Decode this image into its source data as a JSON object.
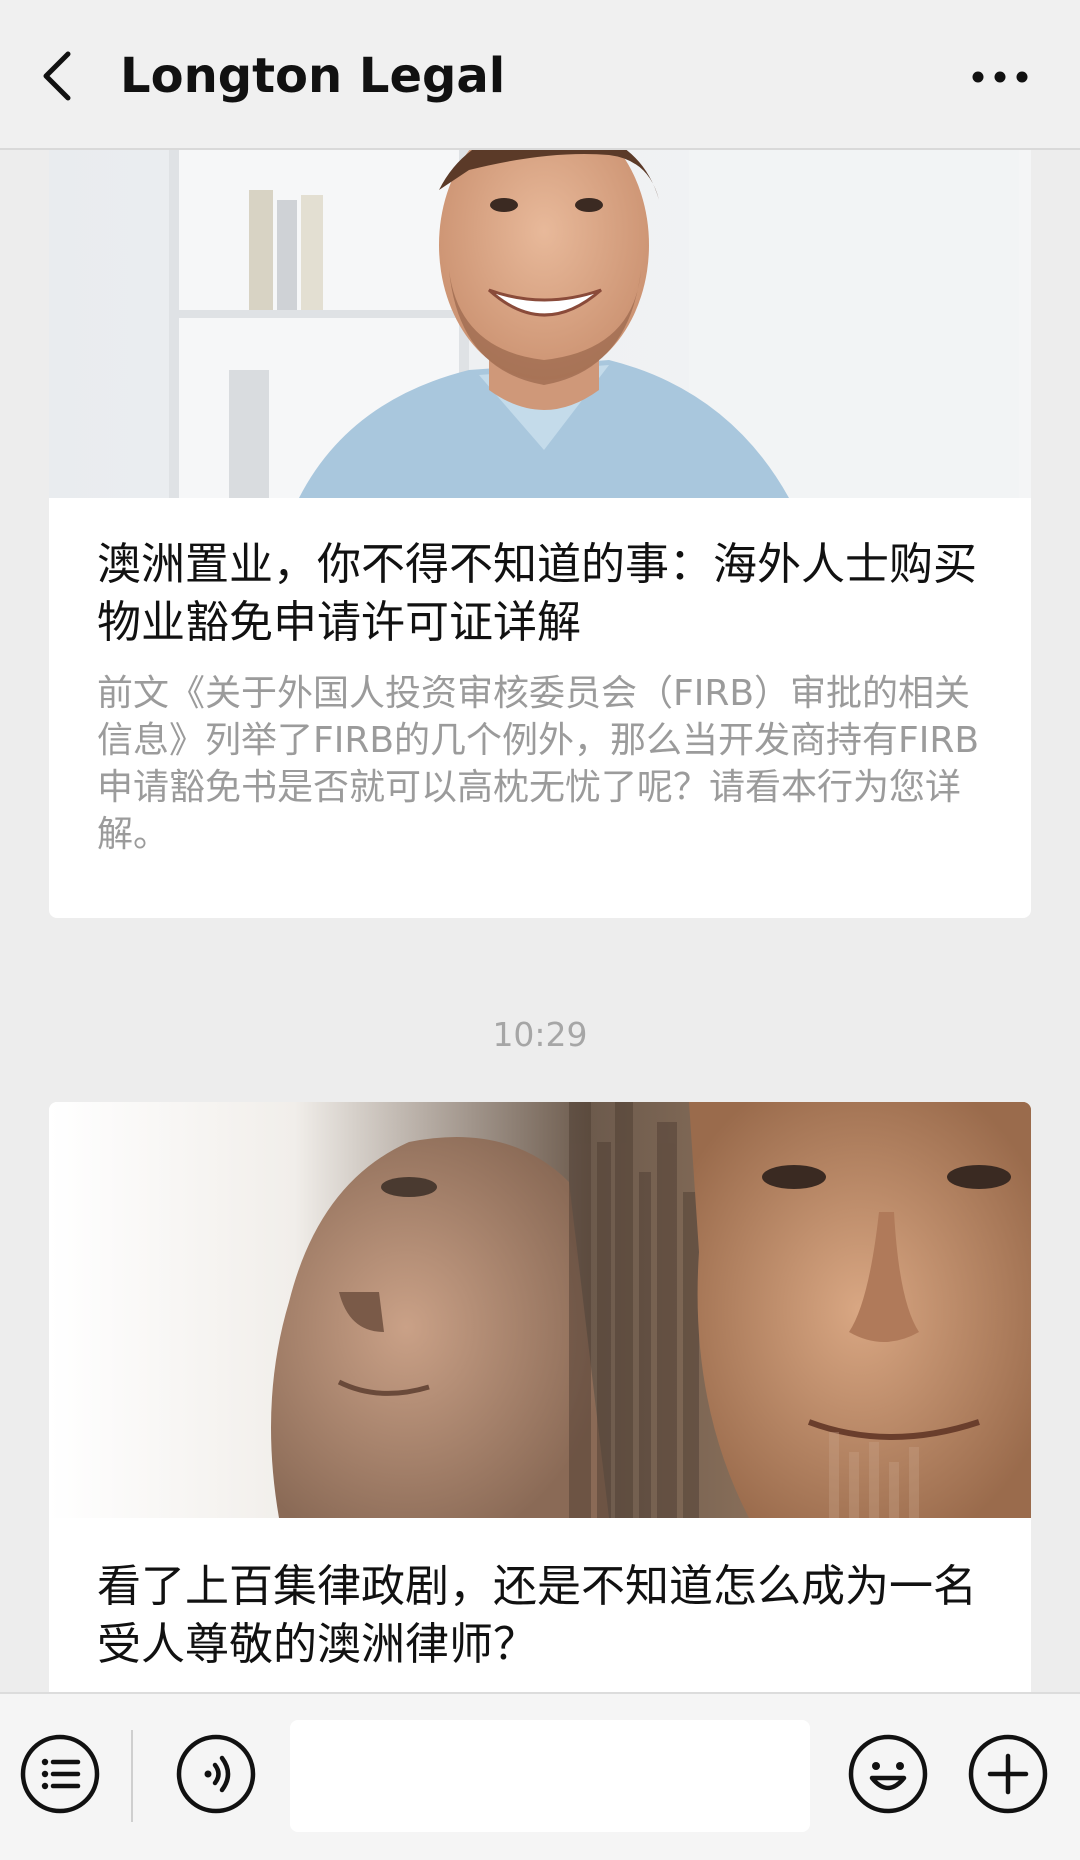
{
  "header": {
    "title": "Longton Legal",
    "back_icon": "chevron-left-icon",
    "more_icon": "more-dots-icon"
  },
  "messages": [
    {
      "image": "smiling-man-in-light-blue-shirt",
      "title": "澳洲置业，你不得不知道的事：海外人士购买物业豁免申请许可证详解",
      "summary": "前文《关于外国人投资审核委员会（FIRB）审批的相关信息》列举了FIRB的几个例外，那么当开发商持有FIRB申请豁免书是否就可以高枕无忧了呢？请看本行为您详解。"
    },
    {
      "timestamp": "10:29",
      "image": "double-exposure-man-faces",
      "title": "看了上百集律政剧，还是不知道怎么成为一名受人尊敬的澳洲律师？"
    }
  ],
  "input_bar": {
    "menu_icon": "list-menu-icon",
    "voice_icon": "voice-icon",
    "input_value": "",
    "emoji_icon": "emoji-icon",
    "plus_icon": "plus-icon"
  },
  "colors": {
    "background": "#ededed",
    "card": "#ffffff",
    "title_text": "#111111",
    "summary_text": "#9b9b9b",
    "timestamp_text": "#a6a6a6"
  }
}
